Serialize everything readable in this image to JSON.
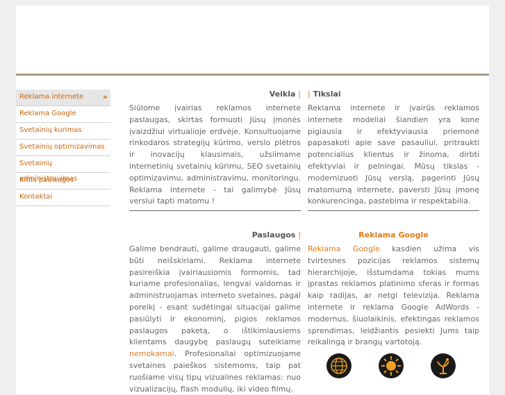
{
  "nav": {
    "items": [
      {
        "label": "Reklama internete",
        "active": true,
        "arrow": "»"
      },
      {
        "label": "Reklama Google"
      },
      {
        "label": "Svetainių kurimas"
      },
      {
        "label": "Svetainių optimizavimas"
      },
      {
        "label": "Svetainių administravimas"
      },
      {
        "label": "Kitos paslaugos"
      },
      {
        "label": "Kontaktai"
      }
    ]
  },
  "sections": {
    "veikla": {
      "title": "Veikla",
      "sep": "|",
      "text": "Siūlome įvairias reklamos internete paslaugas, skirtas formuoti Jūsų įmonės įvaizdžiui virtualioje erdvėje. Konsultuojame rinkodaros strategijų kūrimo, verslo plėtros ir inovacijų klausimais, užsiimame internetinių svetainių kūrimu, SEO svetainių optimizavimu, administravimu, monitoringu. Reklama internete - tai galimybė Jūsų verslui tapti matomu !"
    },
    "tikslai": {
      "sep": "|",
      "title": "Tikslai",
      "text": "Reklama internete ir įvairūs reklamos internete modeliai šiandien yra kone pigiausia ir efektyviausia priemonė papasakoti apie save pasauliui, pritraukti potencialius klientus ir žinoma, dirbti efektyviai ir pelningai. Mūsų tikslas - modernizuoti Jūsų verslą, pagerinti Jūsų matomumą internete, paversti Jūsų įmonę konkurencinga, pastebima ir respektabilia."
    },
    "paslaugos": {
      "title": "Paslaugos",
      "sep": "|",
      "text_before": "Galime bendrauti, galime draugauti, galime būti neišskiriami. Reklama internete pasireiškia įvairiausiomis formomis, tad kuriame profesionalias, lengvai valdomas ir administruojamas interneto svetaines, pagal poreikį - esant sudėtingai situacijai galime pasiūlyti ir ekonominį, pigios reklamos paslaugos paketą, o ištikimiausiems klientams daugybę paslaugų suteikiame ",
      "link": "nemokamai",
      "text_after": ". Profesionaliai optimizuojame svetaines paieškos sistemoms, taip pat ruošiame visų tipų vizualines reklamas: nuo vizualizacijų, flash modulių, iki video filmų."
    },
    "google": {
      "title": "Reklama Google",
      "link": "Reklama Google",
      "text": " kasdien užima vis tvirtesnes pozicijas reklamos sistemų hierarchijoje, išstumdama tokias mums įprastas reklamos platinimo sferas ir formas kaip radijas, ar netgi televizija. Reklama internete ir reklama Google AdWords - modernus, šiuolaikinis, efektingas reklamos sprendimas, leidžiantis pesiekti Jums taip reikalingą ir brangų vartotoją."
    }
  },
  "icons": [
    "globe-icon",
    "sun-icon",
    "satellite-icon"
  ],
  "colors": {
    "accent": "#e07b1a",
    "header_bar": "#a59c86",
    "background": "#efefef"
  }
}
